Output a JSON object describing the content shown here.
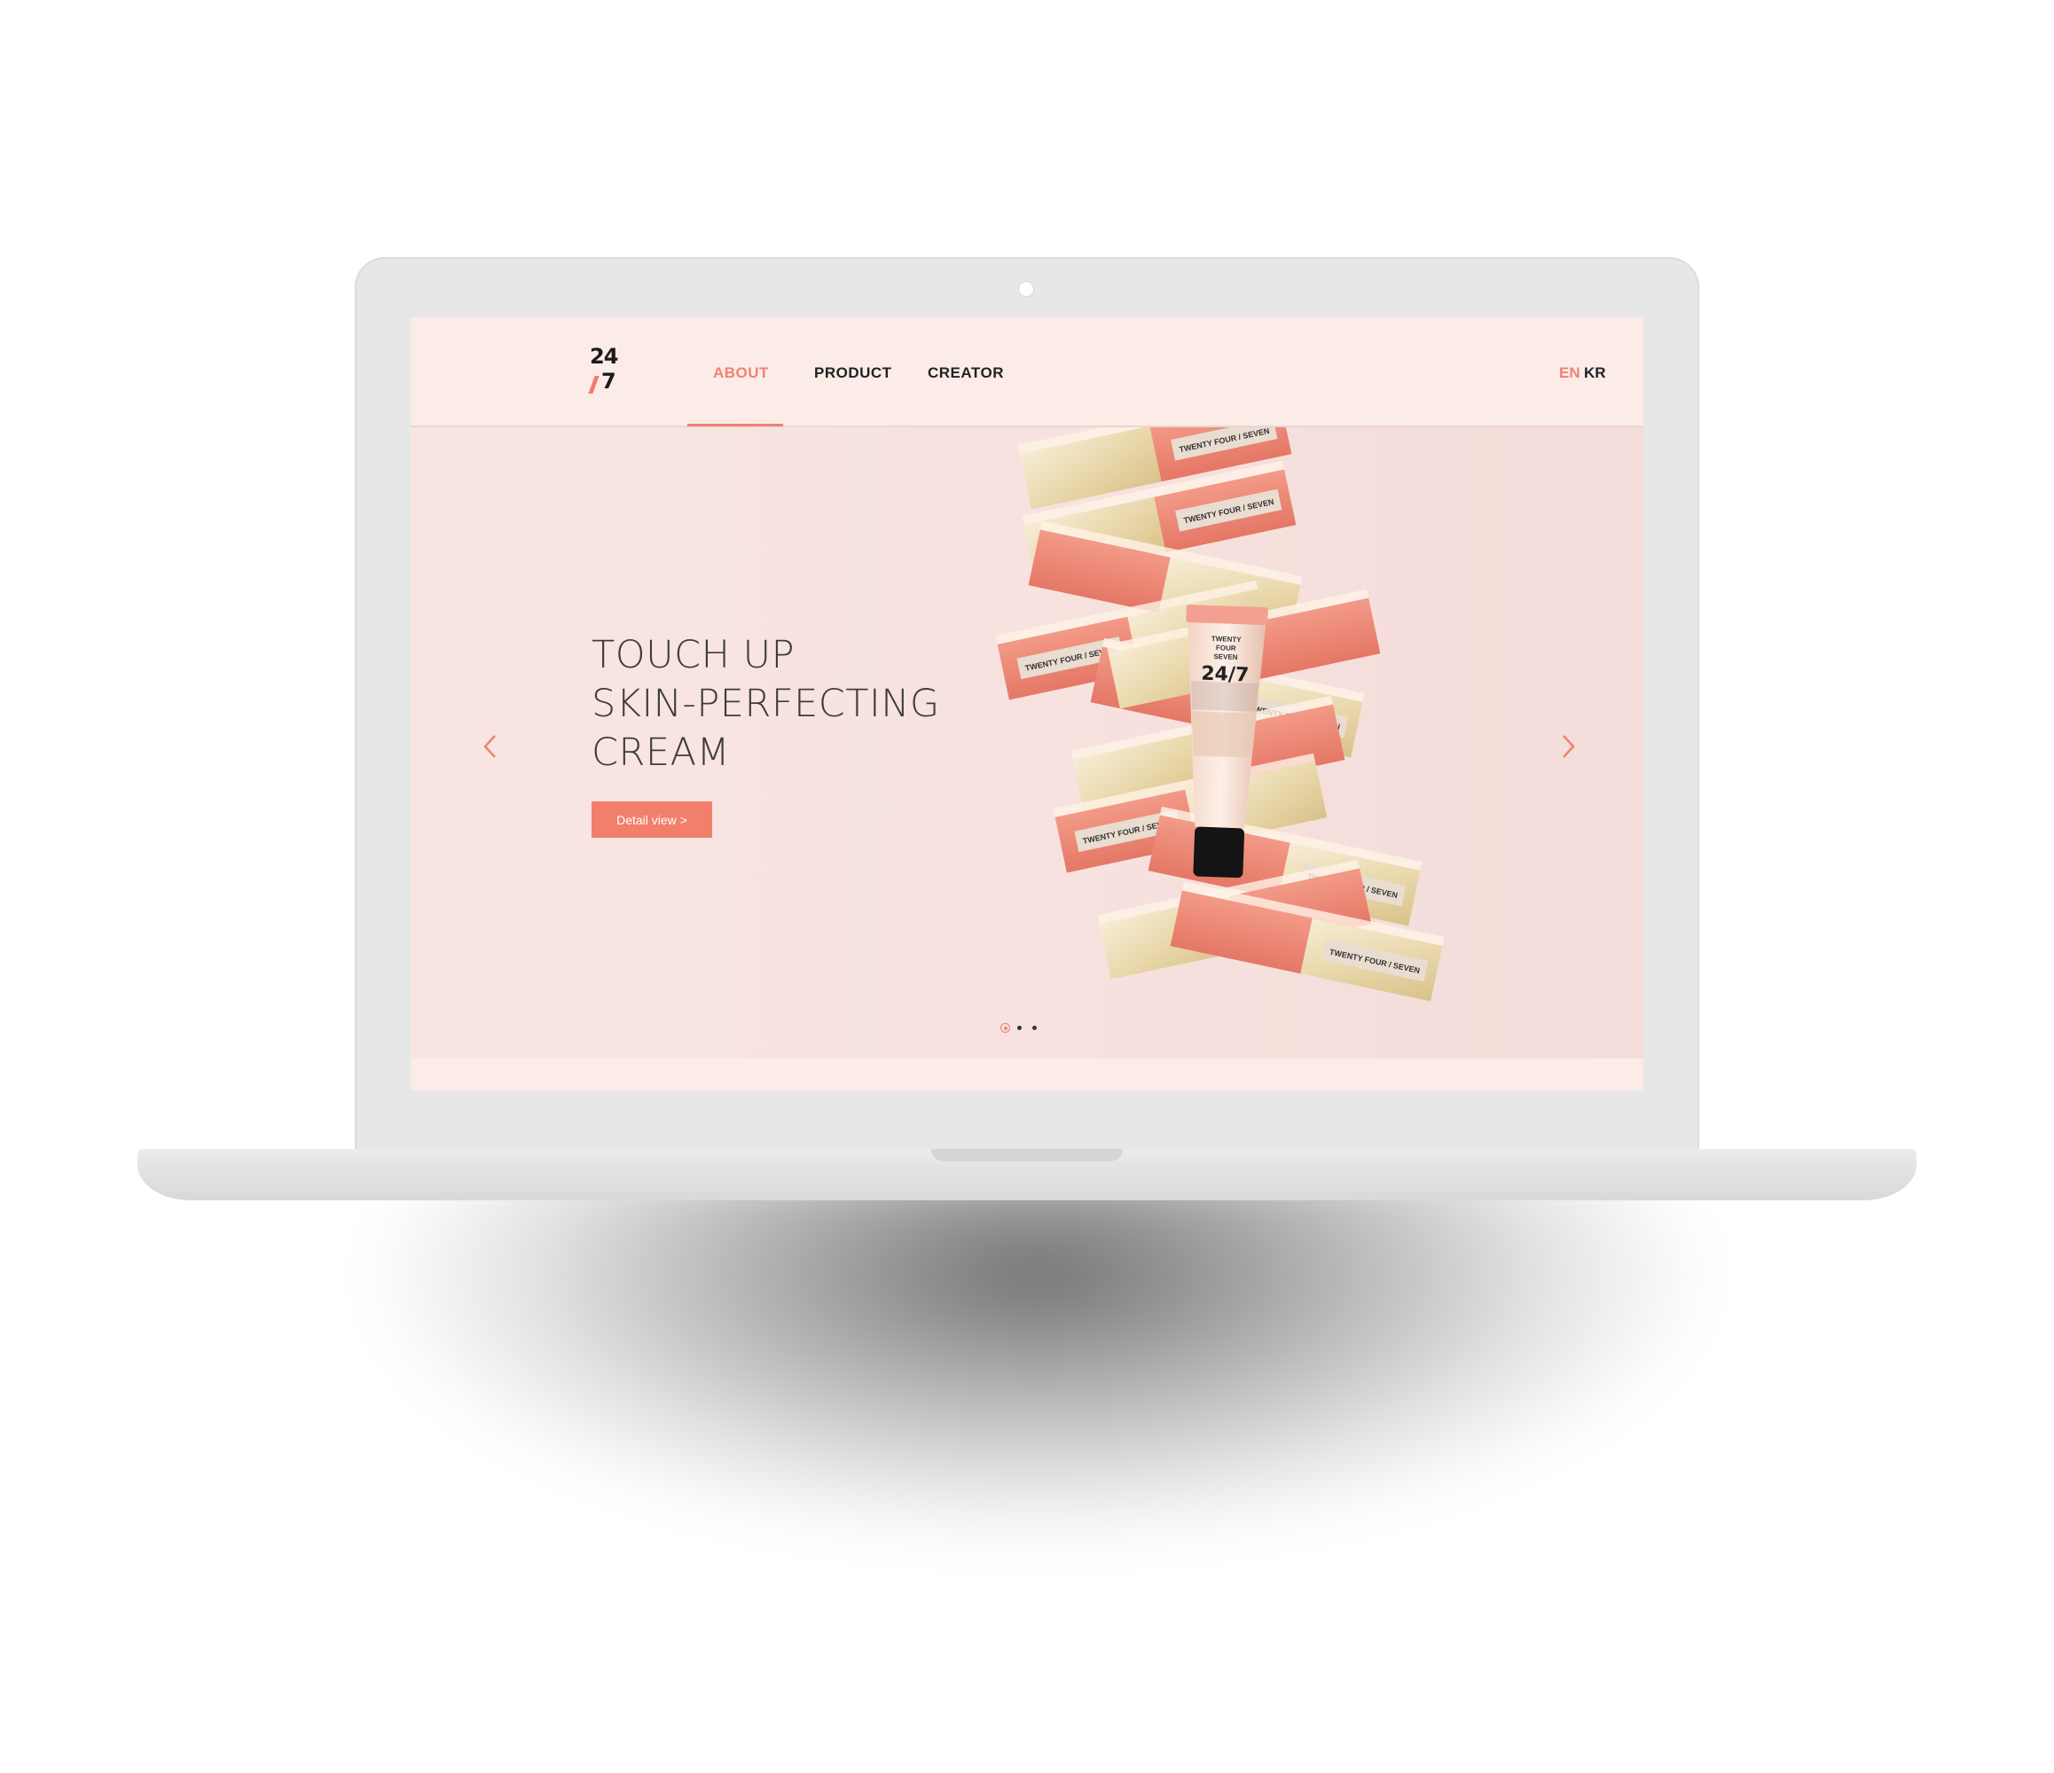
{
  "header": {
    "logo": {
      "line1": "24",
      "line2": "7"
    },
    "nav": [
      {
        "label": "ABOUT",
        "active": true
      },
      {
        "label": "PRODUCT",
        "active": false
      },
      {
        "label": "CREATOR",
        "active": false
      }
    ],
    "languages": [
      {
        "label": "EN",
        "active": true
      },
      {
        "label": "KR",
        "active": false
      }
    ]
  },
  "hero": {
    "title_lines": [
      "TOUCH UP",
      "SKIN-PERFECTING",
      "CREAM"
    ],
    "button_label": "Detail view >",
    "box_label": "TWENTY FOUR / SEVEN",
    "tube_label": [
      "TWENTY",
      "FOUR",
      "SEVEN"
    ],
    "tube_logo": "24/7",
    "slide_count": 3,
    "active_slide": 1
  },
  "colors": {
    "accent": "#f0826f",
    "background": "#f9ebe8",
    "box_coral": "#ef8a79",
    "box_gold": "#efe3c2",
    "text": "#3c3c3c"
  },
  "icons": {
    "prev": "chevron-left-icon",
    "next": "chevron-right-icon",
    "camera": "camera-dot"
  }
}
